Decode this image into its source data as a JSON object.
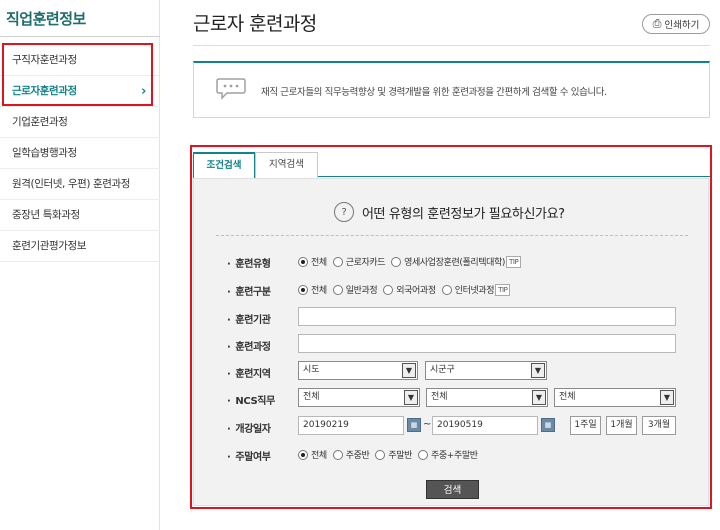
{
  "sidebar": {
    "title": "직업훈련정보",
    "items": [
      {
        "label": "구직자훈련과정"
      },
      {
        "label": "근로자훈련과정",
        "chevron": "›"
      },
      {
        "label": "기업훈련과정"
      },
      {
        "label": "일학습병행과정"
      },
      {
        "label": "원격(인터넷, 우편) 훈련과정"
      },
      {
        "label": "중장년 특화과정"
      },
      {
        "label": "훈련기관평가정보"
      }
    ]
  },
  "header": {
    "title": "근로자 훈련과정",
    "print_label": "인쇄하기"
  },
  "description": "재직 근로자들의 직무능력향상 및 경력개발을 위한 훈련과정을 간편하게 검색할 수 있습니다.",
  "tabs": [
    {
      "label": "조건검색",
      "active": true
    },
    {
      "label": "지역검색",
      "active": false
    }
  ],
  "form": {
    "question": "어떤 유형의 훈련정보가 필요하신가요?",
    "training_type": {
      "label": "훈련유형",
      "options": [
        "전체",
        "근로자카드",
        "영세사업장훈련(폴리텍대학)"
      ],
      "selected": "전체",
      "tip": "TIP"
    },
    "training_class": {
      "label": "훈련구분",
      "options": [
        "전체",
        "일반과정",
        "외국어과정",
        "인터넷과정"
      ],
      "selected": "전체",
      "tip": "TIP"
    },
    "institution": {
      "label": "훈련기관",
      "value": ""
    },
    "course": {
      "label": "훈련과정",
      "value": ""
    },
    "region": {
      "label": "훈련지역",
      "sido": "시도",
      "sigungu": "시군구"
    },
    "ncs": {
      "label": "NCS직무",
      "level1": "전체",
      "level2": "전체",
      "level3": "전체"
    },
    "start_date": {
      "label": "개강일자",
      "from": "20190219",
      "tilde": "~",
      "to": "20190519",
      "periods": [
        "1주일",
        "1개월",
        "3개월"
      ]
    },
    "weekend": {
      "label": "주말여부",
      "options": [
        "전체",
        "주중반",
        "주말반",
        "주중+주말반"
      ],
      "selected": "전체"
    },
    "search_label": "검색"
  },
  "colors": {
    "accent": "#13828a",
    "highlight": "#e0141c"
  }
}
